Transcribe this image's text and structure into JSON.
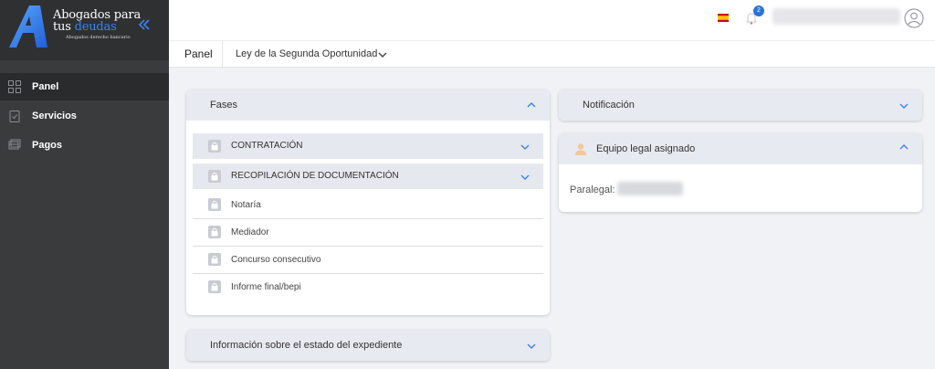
{
  "brand": {
    "line1": "Abogados para",
    "line2_prefix": "tus ",
    "line2_accent": "deudas",
    "subtitle": "Abogados derecho bancario",
    "accent_color": "#3b82f6"
  },
  "sidebar": {
    "items": [
      {
        "label": "Panel",
        "icon": "dashboard-icon",
        "active": true
      },
      {
        "label": "Servicios",
        "icon": "clipboard-icon",
        "active": false
      },
      {
        "label": "Pagos",
        "icon": "payments-icon",
        "active": false
      }
    ]
  },
  "header": {
    "notifications_count": "2",
    "language_icon": "spain-flag-icon"
  },
  "subbar": {
    "panel_label": "Panel",
    "service_select": "Ley de la Segunda Oportunidad"
  },
  "fases": {
    "title": "Fases",
    "phases": [
      {
        "label": "CONTRATACIÓN"
      },
      {
        "label": "RECOPILACIÓN DE DOCUMENTACIÓN"
      }
    ],
    "steps": [
      {
        "label": "Notaría"
      },
      {
        "label": "Mediador"
      },
      {
        "label": "Concurso consecutivo"
      },
      {
        "label": "Informe final/bepi"
      }
    ]
  },
  "info_card": {
    "title": "Información sobre el estado del expediente"
  },
  "notificacion_card": {
    "title": "Notificación"
  },
  "equipo_card": {
    "title": "Equipo legal asignado",
    "paralegal_label": "Paralegal:"
  }
}
